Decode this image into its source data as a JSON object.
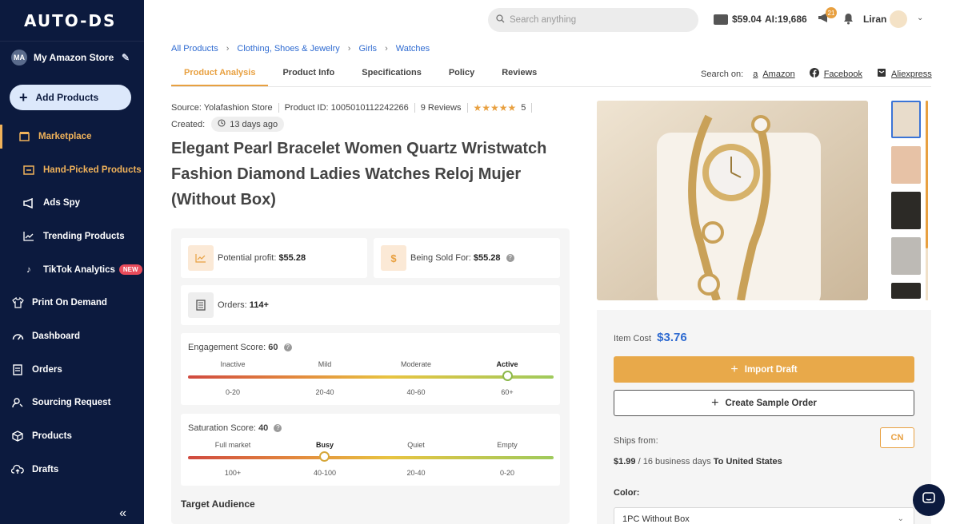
{
  "app": {
    "logo": "AUTO-DS",
    "store_initials": "MA",
    "store_name": "My Amazon Store"
  },
  "sidebar": {
    "add_products": "Add Products",
    "items": [
      {
        "label": "Marketplace"
      },
      {
        "label": "Hand-Picked Products"
      },
      {
        "label": "Ads Spy"
      },
      {
        "label": "Trending Products"
      },
      {
        "label": "TikTok Analytics",
        "badge": "NEW"
      },
      {
        "label": "Print On Demand"
      },
      {
        "label": "Dashboard"
      },
      {
        "label": "Orders"
      },
      {
        "label": "Sourcing Request"
      },
      {
        "label": "Products"
      },
      {
        "label": "Drafts"
      }
    ],
    "collapse_label": "«"
  },
  "header": {
    "search_placeholder": "Search anything",
    "wallet": "$59.04",
    "ai_credits": "AI:19,686",
    "notifications": "21",
    "user_name": "Liran"
  },
  "breadcrumb": [
    "All Products",
    "Clothing, Shoes & Jewelry",
    "Girls",
    "Watches"
  ],
  "tabs": [
    "Product Analysis",
    "Product Info",
    "Specifications",
    "Policy",
    "Reviews"
  ],
  "search_on": {
    "label": "Search on:",
    "links": [
      "Amazon",
      "Facebook",
      "Aliexpress"
    ]
  },
  "product": {
    "source": "Source: Yolafashion Store",
    "product_id": "Product ID: 1005010112242266",
    "reviews": "9 Reviews",
    "stars": "★★★★★",
    "rating": "5",
    "created_label": "Created:",
    "created_value": "13 days ago",
    "title": "Elegant Pearl Bracelet Women Quartz Wristwatch Fashion Diamond Ladies Watches Reloj Mujer (Without Box)"
  },
  "stats": {
    "profit_label": "Potential profit:",
    "profit_value": "$55.28",
    "sold_label": "Being Sold For:",
    "sold_value": "$55.28",
    "orders_label": "Orders:",
    "orders_value": "114+",
    "engagement": {
      "label": "Engagement Score:",
      "value": "60",
      "levels": [
        "Inactive",
        "Mild",
        "Moderate",
        "Active"
      ],
      "ranges": [
        "0-20",
        "20-40",
        "40-60",
        "60+"
      ],
      "active_level": "Active"
    },
    "saturation": {
      "label": "Saturation Score:",
      "value": "40",
      "levels": [
        "Full market",
        "Busy",
        "Quiet",
        "Empty"
      ],
      "ranges": [
        "100+",
        "40-100",
        "20-40",
        "0-20"
      ],
      "active_level": "Busy"
    },
    "target_audience": "Target Audience"
  },
  "buy": {
    "item_cost_label": "Item Cost",
    "item_cost_value": "$3.76",
    "import_label": "Import Draft",
    "sample_label": "Create Sample Order",
    "ships_from_label": "Ships from:",
    "ships_from_value": "CN",
    "ship_price": "$1.99",
    "ship_days": "/ 16 business days",
    "ship_dest": "To United States",
    "color_label": "Color:",
    "color_value": "1PC Without Box"
  },
  "colors": {
    "sidebar_bg": "#0c1a3e",
    "accent": "#e8a040",
    "link": "#2f6bd1"
  }
}
